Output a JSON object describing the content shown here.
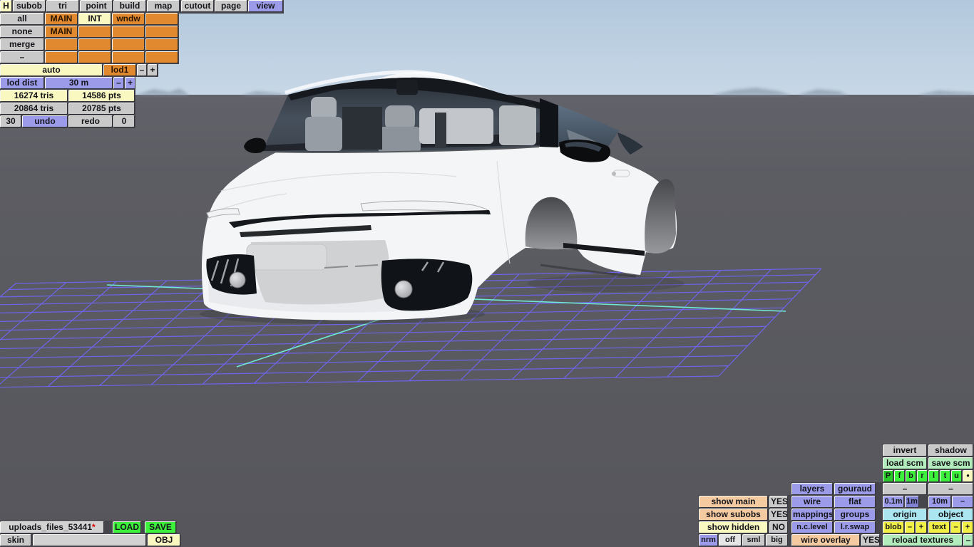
{
  "menu": {
    "items": [
      "H",
      "subob",
      "tri",
      "point",
      "build",
      "map",
      "cutout",
      "page",
      "view"
    ],
    "active": "view"
  },
  "subob_panel": {
    "col0": [
      "all",
      "none",
      "merge",
      "–"
    ],
    "r0": [
      "MAIN",
      "INT",
      "wndw",
      ""
    ],
    "r1": [
      "MAIN",
      "",
      "",
      ""
    ],
    "r2": [
      "",
      "",
      "",
      ""
    ],
    "r3": [
      "",
      "",
      "",
      ""
    ]
  },
  "lod": {
    "auto": "auto",
    "name": "lod1",
    "minus": "–",
    "plus": "+",
    "dist_label": "lod dist",
    "dist_value": "30 m",
    "dist_minus": "–",
    "dist_plus": "+"
  },
  "stats": {
    "sel_tris": "16274 tris",
    "sel_pts": "14586 pts",
    "tot_tris": "20864 tris",
    "tot_pts": "20785 pts",
    "undo_count": "30",
    "undo": "undo",
    "redo": "redo",
    "redo_count": "0"
  },
  "file": {
    "name": "uploads_files_53441",
    "dirty": "*",
    "load": "LOAD",
    "save": "SAVE",
    "skin": "skin",
    "skin_value": "",
    "format": "OBJ"
  },
  "panel": {
    "invert": "invert",
    "shadow": "shadow",
    "load_scm": "load scm",
    "save_scm": "save scm",
    "views": [
      "P",
      "f",
      "b",
      "r",
      "l",
      "t",
      "u",
      "●"
    ],
    "dash_a": "–",
    "dash_b": "–",
    "layers": "layers",
    "gouraud": "gouraud",
    "show_main": "show main",
    "show_main_v": "YES",
    "wire": "wire",
    "flat": "flat",
    "d01": "0.1m",
    "d1": "1m",
    "d10": "10m",
    "ddash": "–",
    "show_subobs": "show subobs",
    "show_subobs_v": "YES",
    "mappings": "mappings",
    "groups": "groups",
    "origin": "origin",
    "object": "object",
    "show_hidden": "show hidden",
    "show_hidden_v": "NO",
    "nclevel": "n.c.level",
    "lrswap": "l.r.swap",
    "blob": "blob",
    "blob_minus": "–",
    "blob_plus": "+",
    "text": "text",
    "text_minus": "–",
    "text_plus": "+",
    "nrm": "nrm",
    "off": "off",
    "sml": "sml",
    "big": "big",
    "wire_overlay": "wire overlay",
    "wire_overlay_v": "YES",
    "reload": "reload textures",
    "reload_dash": "–"
  },
  "viewport": {
    "model": "white coupe car body (no wheels)",
    "sky_color": "#b8cde0",
    "ground_color": "#5c5c63",
    "grid_color": "#6e64ea",
    "axis_color": "#70e8d4",
    "body_color": "#f4f5f7"
  }
}
